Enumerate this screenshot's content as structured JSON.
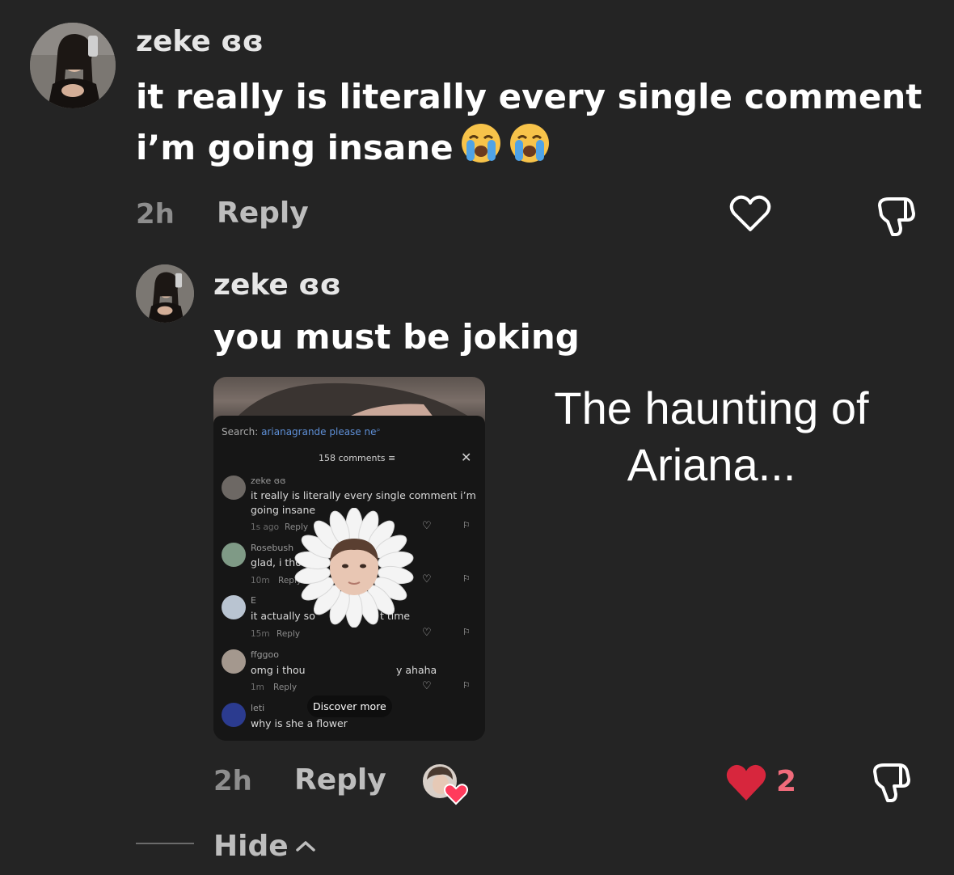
{
  "comment": {
    "username": "zeke ɞɞ",
    "text": "it really is literally every single comment i’m going insane",
    "emojis": [
      "loudly-crying-face-icon",
      "loudly-crying-face-icon"
    ],
    "time": "2h",
    "reply_label": "Reply"
  },
  "reply": {
    "username": "zeke ɞɞ",
    "text": "you must be joking",
    "time": "2h",
    "reply_label": "Reply",
    "like_count": "2"
  },
  "embedded_screenshot": {
    "search_label": "Search:",
    "search_query": "arianagrande please ne",
    "comments_count": "158 comments",
    "comments": [
      {
        "user": "zeke ɞɞ",
        "text_line1": "it really is literally every single comment i’m",
        "text_line2": "going insane",
        "time": "1s ago",
        "reply": "Reply"
      },
      {
        "user": "Rosebush",
        "text": "glad, i thou",
        "time": "10m",
        "reply": "Reply"
      },
      {
        "user": "E",
        "text": "it actually so",
        "text_tail": "t time",
        "time": "15m",
        "reply": "Reply"
      },
      {
        "user": "ffggoo",
        "text": "omg i thou",
        "text_tail": "y ahaha",
        "time": "1m",
        "reply": "Reply"
      },
      {
        "user": "leti",
        "text": "why is she a flower"
      }
    ],
    "discover_label": "Discover more"
  },
  "caption": {
    "line1": "The haunting of",
    "line2": "Ariana..."
  },
  "hide_label": "Hide",
  "colors": {
    "background": "#242424",
    "liked_heart": "#d7263d",
    "like_count": "#f06b7b"
  }
}
